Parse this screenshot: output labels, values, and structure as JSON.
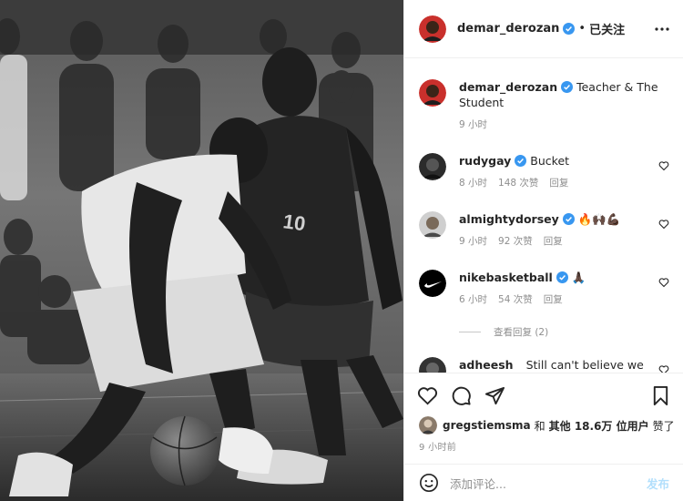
{
  "post": {
    "author": "demar_derozan",
    "separator": "•",
    "follow_status": "已关注",
    "caption": "Teacher & The Student",
    "caption_time": "9 小时",
    "jersey_number": "10"
  },
  "comments": [
    {
      "user": "rudygay",
      "verified": true,
      "text": "Bucket",
      "time": "8 小时",
      "likes": "148 次赞",
      "reply": "回复",
      "avatar": "dark-portrait"
    },
    {
      "user": "almightydorsey",
      "verified": true,
      "text": "🔥🙌🏿💪🏿",
      "time": "9 小时",
      "likes": "92 次赞",
      "reply": "回复",
      "avatar": "light-portrait"
    },
    {
      "user": "nikebasketball",
      "verified": true,
      "text": "🙏🏿",
      "time": "6 小时",
      "likes": "54 次赞",
      "reply": "回复",
      "avatar": "nike-swoosh"
    },
    {
      "user": "adheesh",
      "verified": false,
      "text": "Still can't believe we",
      "time": "",
      "likes": "",
      "reply": "",
      "avatar": "dark-portrait"
    }
  ],
  "view_replies": "查看回复 (2)",
  "likes_line": {
    "user": "gregstiemsma",
    "connector": "和",
    "others": "其他 18.6万 位用户",
    "suffix": "赞了"
  },
  "post_time": "9 小时前",
  "add_comment": {
    "placeholder": "添加评论...",
    "post_label": "发布"
  },
  "colors": {
    "verified": "#3897f0",
    "text": "#262626",
    "muted": "#8e8e8e",
    "post_disabled": "#b2dffc",
    "border": "#efefef"
  },
  "icons": [
    "more-options-icon",
    "verified-badge-icon",
    "heart-icon",
    "comment-icon",
    "share-icon",
    "bookmark-icon",
    "emoji-icon"
  ]
}
